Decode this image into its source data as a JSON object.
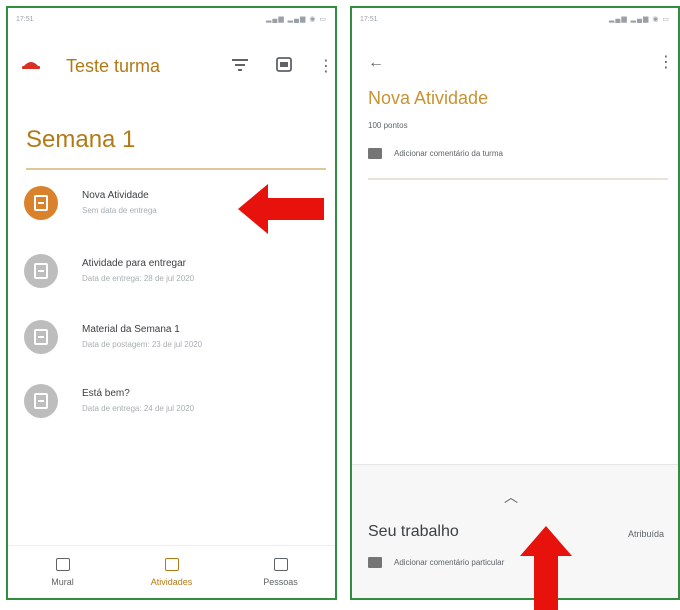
{
  "left": {
    "status": {
      "time": "17:51",
      "icons": "▂▄▆ ▂▄▆ ◉ ▭"
    },
    "class_title": "Teste turma",
    "topic": "Semana 1",
    "items": [
      {
        "title": "Nova Atividade",
        "subtitle": "Sem data de entrega"
      },
      {
        "title": "Atividade para entregar",
        "subtitle": "Data de entrega: 28 de jul 2020"
      },
      {
        "title": "Material da Semana 1",
        "subtitle": "Data de postagem: 23 de jul 2020"
      },
      {
        "title": "Está bem?",
        "subtitle": "Data de entrega: 24 de jul 2020"
      }
    ],
    "nav": {
      "stream": "Mural",
      "classwork": "Atividades",
      "people": "Pessoas"
    }
  },
  "right": {
    "status": {
      "time": "17:51",
      "icons": "▂▄▆ ▂▄▆ ◉ ▭"
    },
    "activity_title": "Nova Atividade",
    "points": "100 pontos",
    "add_comment": "Adicionar comentário da turma",
    "your_work": "Seu trabalho",
    "work_status": "Atribuída",
    "private_comment": "Adicionar comentário particular"
  },
  "colors": {
    "accent": "#b27a16",
    "arrow": "#e8120c",
    "frame": "#2f8f3f"
  }
}
